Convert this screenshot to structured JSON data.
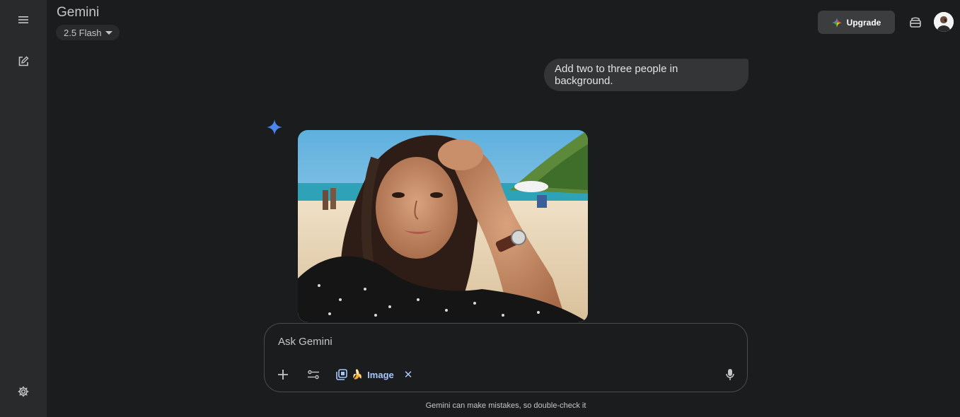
{
  "app": {
    "title": "Gemini",
    "model_label": "2.5 Flash"
  },
  "header": {
    "upgrade_label": "Upgrade"
  },
  "conversation": {
    "user_message": "Add two to three people in background."
  },
  "composer": {
    "placeholder": "Ask Gemini",
    "tool_chip_emoji": "🍌",
    "tool_chip_label": "Image",
    "tool_chip_close": "✕"
  },
  "footer": {
    "disclaimer": "Gemini can make mistakes, so double-check it"
  },
  "icons": {
    "menu": "menu-icon",
    "new_chat": "edit-icon",
    "settings": "gear-icon",
    "upgrade_spark": "spark-icon",
    "temp_chat": "incognito-icon",
    "add": "plus-icon",
    "tools": "tune-icon",
    "gallery": "image-gallery-icon",
    "mic": "mic-icon"
  },
  "colors": {
    "accent": "#a8c7fa",
    "background": "#1b1c1d",
    "sidebar": "#282a2c"
  }
}
